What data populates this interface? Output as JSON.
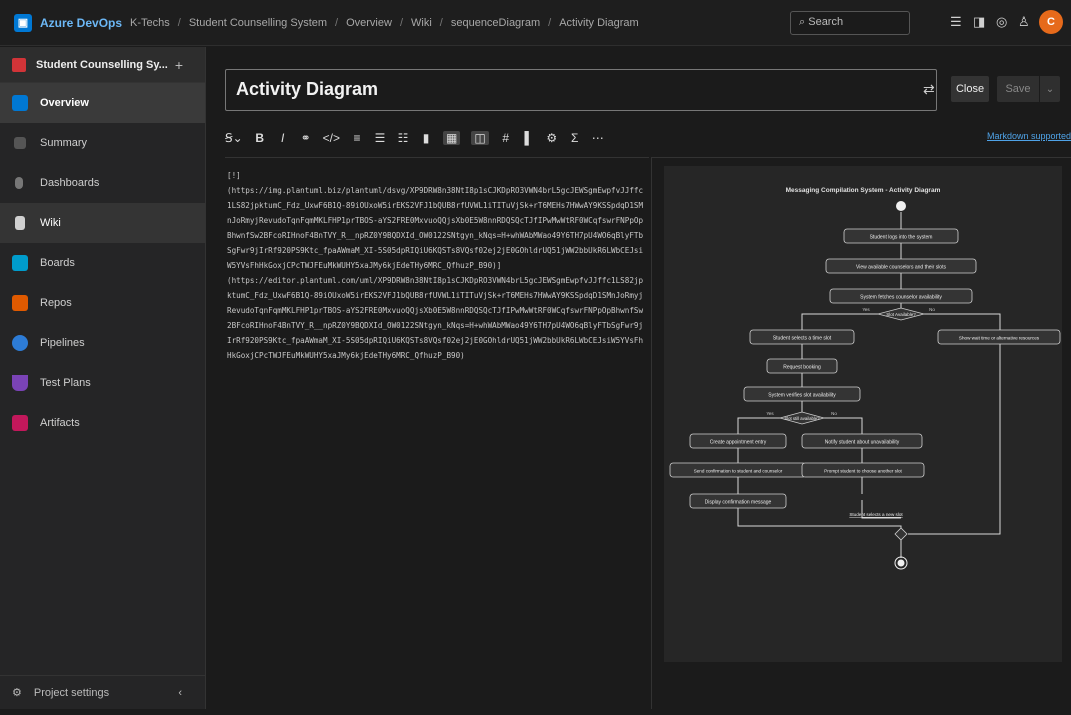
{
  "topbar": {
    "brand": "Azure DevOps",
    "breadcrumbs": [
      "K-Techs",
      "Student Counselling System",
      "Overview",
      "Wiki",
      "sequenceDiagram",
      "Activity Diagram"
    ],
    "search_placeholder": "Search",
    "avatar_initial": "C"
  },
  "sidebar": {
    "project_name": "Student Counselling Sy...",
    "items": [
      {
        "label": "Overview",
        "color": "#0078d4"
      },
      {
        "label": "Summary",
        "color": "#555555"
      },
      {
        "label": "Dashboards",
        "color": "#444444"
      },
      {
        "label": "Wiki",
        "color": "#444444"
      },
      {
        "label": "Boards",
        "color": "#009ccc"
      },
      {
        "label": "Repos",
        "color": "#e05a00"
      },
      {
        "label": "Pipelines",
        "color": "#2d7cd6"
      },
      {
        "label": "Test Plans",
        "color": "#7a43b6"
      },
      {
        "label": "Artifacts",
        "color": "#c2185b"
      }
    ],
    "settings_label": "Project settings"
  },
  "editor": {
    "page_title": "Activity Diagram",
    "close_label": "Close",
    "save_label": "Save",
    "markdown_link": "Markdown supported.",
    "content": "[!]\n(https://img.plantuml.biz/plantuml/dsvg/XP9DRW8n38NtI8p1sCJKDpRO3VWN4brL5gcJEWSgmEwpfvJJffc1LS82jpktumC_Fdz_UxwF6B1Q-89iOUxoW5irEKS2VFJ1bQUB8rfUVWL1iTITuVjSk+rT6MEHs7HWwAY9KSSpdqD1SMnJoRmyjRevudoTqnFqmMKLFHP1prTBOS-aYS2FRE0MxvuoQQjsXb0E5W8nnRDQSQcTJfIPwMwWtRF0WCqfswrFNPpOpBhwnfSw2BFcoRIHnoF4BnTVY_R__npRZ0Y9BQDXId_OW0122SNtgyn_kNqs=H+whWAbMWao49Y6TH7pU4WO6qBlyFTbSgFwr9jIrRf920PS9Ktc_fpaAWmaM_XI-5S05dpRIQiU6KQSTs8VQsf02ej2jE0GOhldrUQ51jWW2bbUkR6LWbCEJsiW5YVsFhHkGoxjCPcTWJFEuMkWUHY5xaJMy6kjEdeTHy6MRC_QfhuzP_B90)]\n(https://editor.plantuml.com/uml/XP9DRW8n38NtI8p1sCJKDpRO3VWN4brL5gcJEWSgmEwpfvJJffc1LS82jpktumC_Fdz_UxwF6B1Q-89iOUxoW5irEKS2VFJ1bQUB8rfUVWL1iTITuVjSk+rT6MEHs7HWwAY9KSSpdqD1SMnJoRmyjRevudoTqnFqmMKLFHP1prTBOS-aYS2FRE0MxvuoQQjsXb0E5W8nnRDQSQcTJfIPwMwWtRF0WCqfswrFNPpOpBhwnfSw2BFcoRIHnoF4BnTVY_R__npRZ0Y9BQDXId_OW0122SNtgyn_kNqs=H+whWAbMWao49Y6TH7pU4WO6qBlyFTbSgFwr9jIrRf920PS9Ktc_fpaAWmaM_XI-5S05dpRIQiU6KQSTs8VQsf02ej2jE0GOhldrUQ51jWW2bbUkR6LWbCEJsiW5YVsFhHkGoxjCPcTWJFEuMkWUHY5xaJMy6kjEdeTHy6MRC_QfhuzP_B90)"
  },
  "diagram": {
    "title": "Messaging Compilation System - Activity Diagram",
    "nodes": [
      "Student logs into the system",
      "View available counselors and their slots",
      "System fetches counselor availability",
      "Slot Available?",
      "Student selects a time slot",
      "Show wait time or alternative resources",
      "Request booking",
      "System verifies slot availability",
      "Slot still available?",
      "Create appointment entry",
      "Notify student about unavailability",
      "Send confirmation to student and counselor",
      "Prompt student to choose another slot",
      "Display confirmation message",
      "Student selects a new slot"
    ],
    "labels": {
      "yes": "Yes",
      "no": "No"
    }
  }
}
